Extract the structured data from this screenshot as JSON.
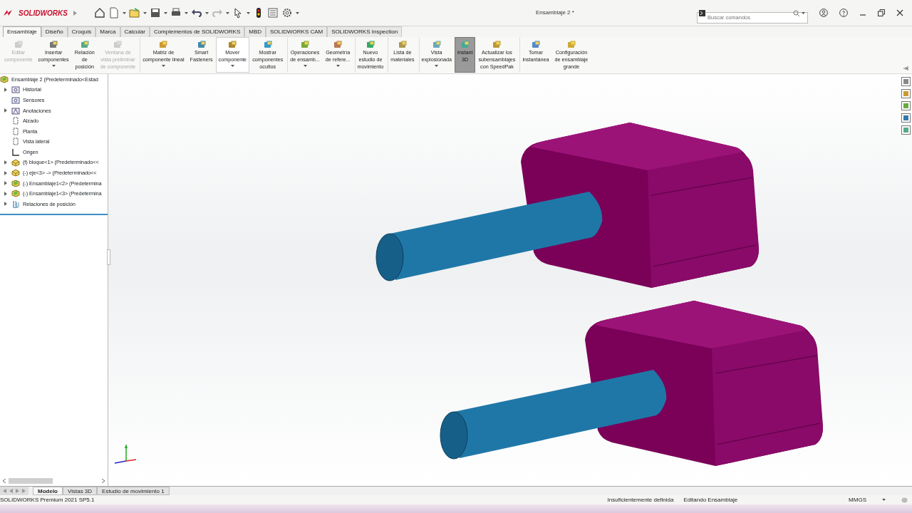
{
  "title_bar": {
    "app_name": "SOLIDWORKS",
    "document": "Ensamblaje 2 *",
    "search": {
      "placeholder": "Buscar comandos"
    }
  },
  "tabs": [
    {
      "label": "Ensamblaje",
      "selected": true
    },
    {
      "label": "Diseño",
      "selected": false
    },
    {
      "label": "Croquis",
      "selected": false
    },
    {
      "label": "Marca",
      "selected": false
    },
    {
      "label": "Calcular",
      "selected": false
    },
    {
      "label": "Complementos de SOLIDWORKS",
      "selected": false
    },
    {
      "label": "MBD",
      "selected": false
    },
    {
      "label": "SOLIDWORKS CAM",
      "selected": false
    },
    {
      "label": "SOLIDWORKS Inspection",
      "selected": false
    }
  ],
  "ribbon": [
    {
      "lines": [
        "Editar",
        "componente"
      ],
      "disabled": true,
      "dropdown": false,
      "active": false,
      "hovered": false,
      "separator_before": false
    },
    {
      "lines": [
        "Insertar",
        "componentes"
      ],
      "disabled": false,
      "dropdown": true,
      "active": false,
      "hovered": false,
      "separator_before": false
    },
    {
      "lines": [
        "Relación",
        "de",
        "posición"
      ],
      "disabled": false,
      "dropdown": false,
      "active": false,
      "hovered": false,
      "separator_before": false
    },
    {
      "lines": [
        "Ventana de",
        "vista preliminar",
        "de componente"
      ],
      "disabled": true,
      "dropdown": false,
      "active": false,
      "hovered": false,
      "separator_before": false
    },
    {
      "lines": [
        "Matriz de",
        "componente lineal"
      ],
      "disabled": false,
      "dropdown": true,
      "active": false,
      "hovered": false,
      "separator_before": true
    },
    {
      "lines": [
        "Smart",
        "Fasteners"
      ],
      "disabled": false,
      "dropdown": false,
      "active": false,
      "hovered": false,
      "separator_before": false
    },
    {
      "lines": [
        "Mover",
        "componente"
      ],
      "disabled": false,
      "dropdown": true,
      "active": false,
      "hovered": true,
      "separator_before": false
    },
    {
      "lines": [
        "Mostrar",
        "componentes",
        "ocultos"
      ],
      "disabled": false,
      "dropdown": false,
      "active": false,
      "hovered": false,
      "separator_before": false
    },
    {
      "lines": [
        "Operaciones",
        "de ensamb..."
      ],
      "disabled": false,
      "dropdown": true,
      "active": false,
      "hovered": false,
      "separator_before": true
    },
    {
      "lines": [
        "Geometría",
        "de refere..."
      ],
      "disabled": false,
      "dropdown": true,
      "active": false,
      "hovered": false,
      "separator_before": false
    },
    {
      "lines": [
        "Nuevo",
        "estudio de",
        "movimiento"
      ],
      "disabled": false,
      "dropdown": false,
      "active": false,
      "hovered": false,
      "separator_before": true
    },
    {
      "lines": [
        "Lista de",
        "materiales"
      ],
      "disabled": false,
      "dropdown": false,
      "active": false,
      "hovered": false,
      "separator_before": true
    },
    {
      "lines": [
        "Vista",
        "explosionada"
      ],
      "disabled": false,
      "dropdown": true,
      "active": false,
      "hovered": false,
      "separator_before": true
    },
    {
      "lines": [
        "Instant",
        "3D"
      ],
      "disabled": false,
      "dropdown": false,
      "active": true,
      "hovered": false,
      "separator_before": false
    },
    {
      "lines": [
        "Actualizar los",
        "subensamblajes",
        "con SpeedPak"
      ],
      "disabled": false,
      "dropdown": false,
      "active": false,
      "hovered": false,
      "separator_before": false
    },
    {
      "lines": [
        "Tomar",
        "instantánea"
      ],
      "disabled": false,
      "dropdown": false,
      "active": false,
      "hovered": false,
      "separator_before": true
    },
    {
      "lines": [
        "Configuración",
        "de ensamblaje",
        "grande"
      ],
      "disabled": false,
      "dropdown": false,
      "active": false,
      "hovered": false,
      "separator_before": false
    }
  ],
  "tree": {
    "root": {
      "label": "Ensamblaje 2  (Predeterminado<Estad",
      "kind": "assembly"
    },
    "items": [
      {
        "label": "Historial",
        "kind": "folder",
        "expandable": true
      },
      {
        "label": "Sensores",
        "kind": "folder",
        "expandable": false
      },
      {
        "label": "Anotaciones",
        "kind": "annotation",
        "expandable": true
      },
      {
        "label": "Alzado",
        "kind": "plane",
        "expandable": false
      },
      {
        "label": "Planta",
        "kind": "plane",
        "expandable": false
      },
      {
        "label": "Vista lateral",
        "kind": "plane",
        "expandable": false
      },
      {
        "label": "Origen",
        "kind": "origin",
        "expandable": false
      },
      {
        "label": "(f) bloque<1> (Predeterminado<<",
        "kind": "part",
        "expandable": true
      },
      {
        "label": "(-) eje<3> -> (Predeterminado<<",
        "kind": "part",
        "expandable": true
      },
      {
        "label": "(-) Ensamblaje1<2> (Predetermina",
        "kind": "assembly",
        "expandable": true
      },
      {
        "label": "(-) Ensamblaje1<3> (Predetermina",
        "kind": "assembly",
        "expandable": true
      },
      {
        "label": "Relaciones de posición",
        "kind": "mates",
        "expandable": true
      }
    ]
  },
  "bottom_tabs": [
    {
      "label": "Modelo",
      "selected": true
    },
    {
      "label": "Vistas 3D",
      "selected": false
    },
    {
      "label": "Estudio de movimiento 1",
      "selected": false
    }
  ],
  "status_bar": {
    "product": "SOLIDWORKS Premium 2021 SP5.1",
    "definition": "Insuficientemente definida",
    "mode": "Editando Ensamblaje",
    "units": "MMGS"
  }
}
